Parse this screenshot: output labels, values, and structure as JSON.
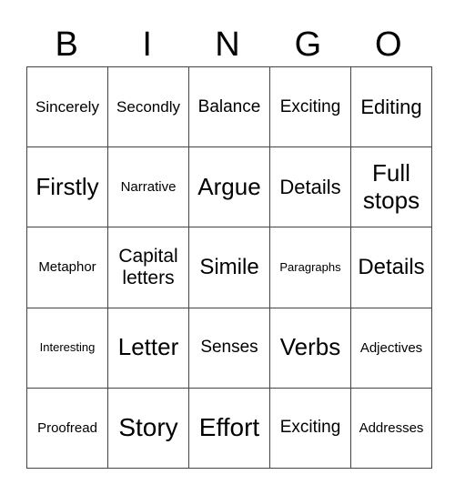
{
  "title_letters": [
    "B",
    "I",
    "N",
    "G",
    "O"
  ],
  "cells": [
    [
      "Sincerely",
      "Secondly",
      "Balance",
      "Exciting",
      "Editing"
    ],
    [
      "Firstly",
      "Narrative",
      "Argue",
      "Details",
      "Full stops"
    ],
    [
      "Metaphor",
      "Capital letters",
      "Simile",
      "Paragraphs",
      "Details"
    ],
    [
      "Interesting",
      "Letter",
      "Senses",
      "Verbs",
      "Adjectives"
    ],
    [
      "Proofread",
      "Story",
      "Effort",
      "Exciting",
      "Addresses"
    ]
  ]
}
